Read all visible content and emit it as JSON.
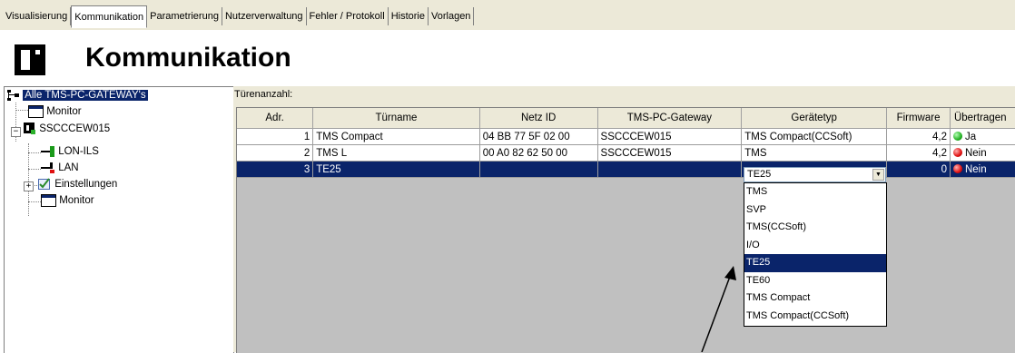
{
  "tabs": [
    {
      "label": "Visualisierung",
      "active": false
    },
    {
      "label": "Kommunikation",
      "active": true
    },
    {
      "label": "Parametrierung",
      "active": false
    },
    {
      "label": "Nutzerverwaltung",
      "active": false
    },
    {
      "label": "Fehler / Protokoll",
      "active": false
    },
    {
      "label": "Historie",
      "active": false
    },
    {
      "label": "Vorlagen",
      "active": false
    }
  ],
  "header": {
    "title": "Kommunikation",
    "logo_icon": "company-logo"
  },
  "tree": {
    "root": "Alle TMS-PC-GATEWAY's",
    "monitor1": "Monitor",
    "device": "SSCCCEW015",
    "lon": "LON-ILS",
    "lan": "LAN",
    "settings": "Einstellungen",
    "monitor2": "Monitor"
  },
  "main": {
    "count_label": "Türenanzahl:",
    "columns": [
      "Adr.",
      "Türname",
      "Netz ID",
      "TMS-PC-Gateway",
      "Gerätetyp",
      "Firmware",
      "Übertragen"
    ],
    "rows": [
      {
        "adr": "1",
        "name": "TMS Compact",
        "netz": "04 BB 77 5F 02 00",
        "gateway": "SSCCCEW015",
        "type": "TMS Compact(CCSoft)",
        "fw": "4,2",
        "status": "Ja",
        "status_color": "green"
      },
      {
        "adr": "2",
        "name": "TMS L",
        "netz": "00 A0 82 62 50 00",
        "gateway": "SSCCCEW015",
        "type": "TMS",
        "fw": "4,2",
        "status": "Nein",
        "status_color": "red"
      },
      {
        "adr": "3",
        "name": "TE25",
        "netz": "",
        "gateway": "",
        "type": "TE25",
        "fw": "0",
        "status": "Nein",
        "status_color": "red"
      }
    ]
  },
  "combo": {
    "value": "TE25",
    "options": [
      "TMS",
      "SVP",
      "TMS(CCSoft)",
      "I/O",
      "TE25",
      "TE60",
      "TMS Compact",
      "TMS Compact(CCSoft)"
    ],
    "selected": "TE25"
  },
  "colors": {
    "selection": "#0a246a",
    "panel": "#ece9d8",
    "ok": "#22b022",
    "fail": "#e01010"
  }
}
